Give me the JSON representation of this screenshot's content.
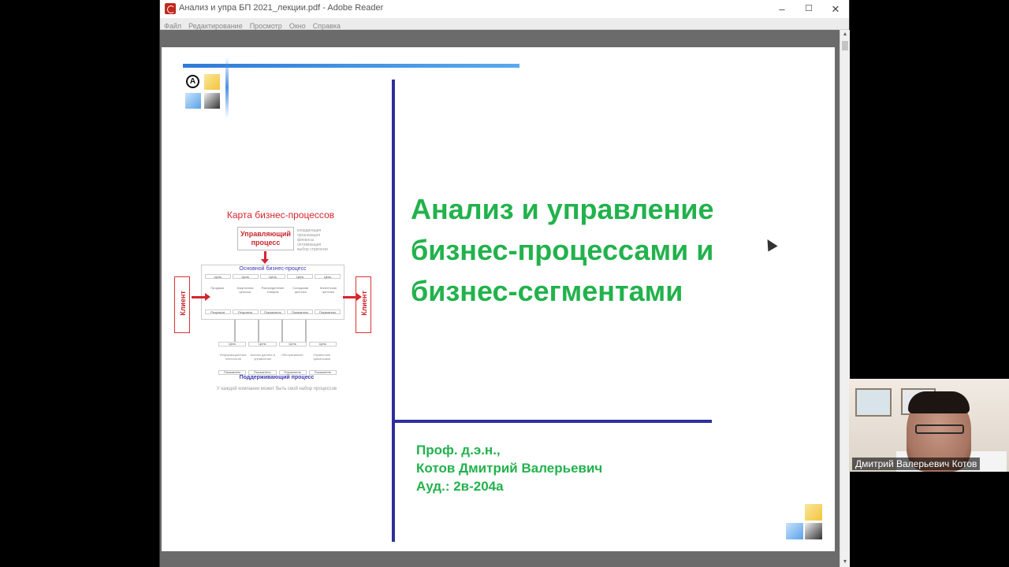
{
  "window": {
    "title": "Анализ и упра БП 2021_лекции.pdf - Adobe Reader",
    "minimize": "–",
    "maximize": "☐",
    "close": "✕",
    "doc_close": "✕"
  },
  "menu": [
    "Файл",
    "Редактирование",
    "Просмотр",
    "Окно",
    "Справка"
  ],
  "slide": {
    "logo_mark": "А",
    "title_lines": [
      "Анализ и управление",
      "бизнес-процессами и",
      "бизнес-сегментами"
    ],
    "author_lines": [
      "Проф. д.э.н.,",
      "Котов Дмитрий Валерьевич",
      "Ауд.: 2в-204а"
    ],
    "map": {
      "title": "Карта бизнес-процессов",
      "managing_process": "Управляющий процесс",
      "notes": "координация\nорганизация\nфинансы\nоптимизация\nвыбор стратегии",
      "core_process": "Основной бизнес-процесс",
      "goal": "Цель",
      "result": "Результат",
      "indicator": "Показатель",
      "stages": [
        "Продажа",
        "Закупочная цепочка",
        "Распределение товаров",
        "Складская цепочка",
        "Клиентская цепочка"
      ],
      "client": "Клиент",
      "support_steps": [
        "Информационные технологии",
        "Анализ данных и управление",
        "Обслуживание",
        "Управление финансами"
      ],
      "supporting_process": "Поддерживающий процесс",
      "footer": "У каждой компании может быть свой набор процессов"
    }
  },
  "webcam": {
    "name": "Дмитрий Валерьевич Котов"
  },
  "colors": {
    "title_green": "#22b24c",
    "navy": "#2f2f9b",
    "accent_blue": "#2e7bd8",
    "map_red": "#d4262c"
  }
}
